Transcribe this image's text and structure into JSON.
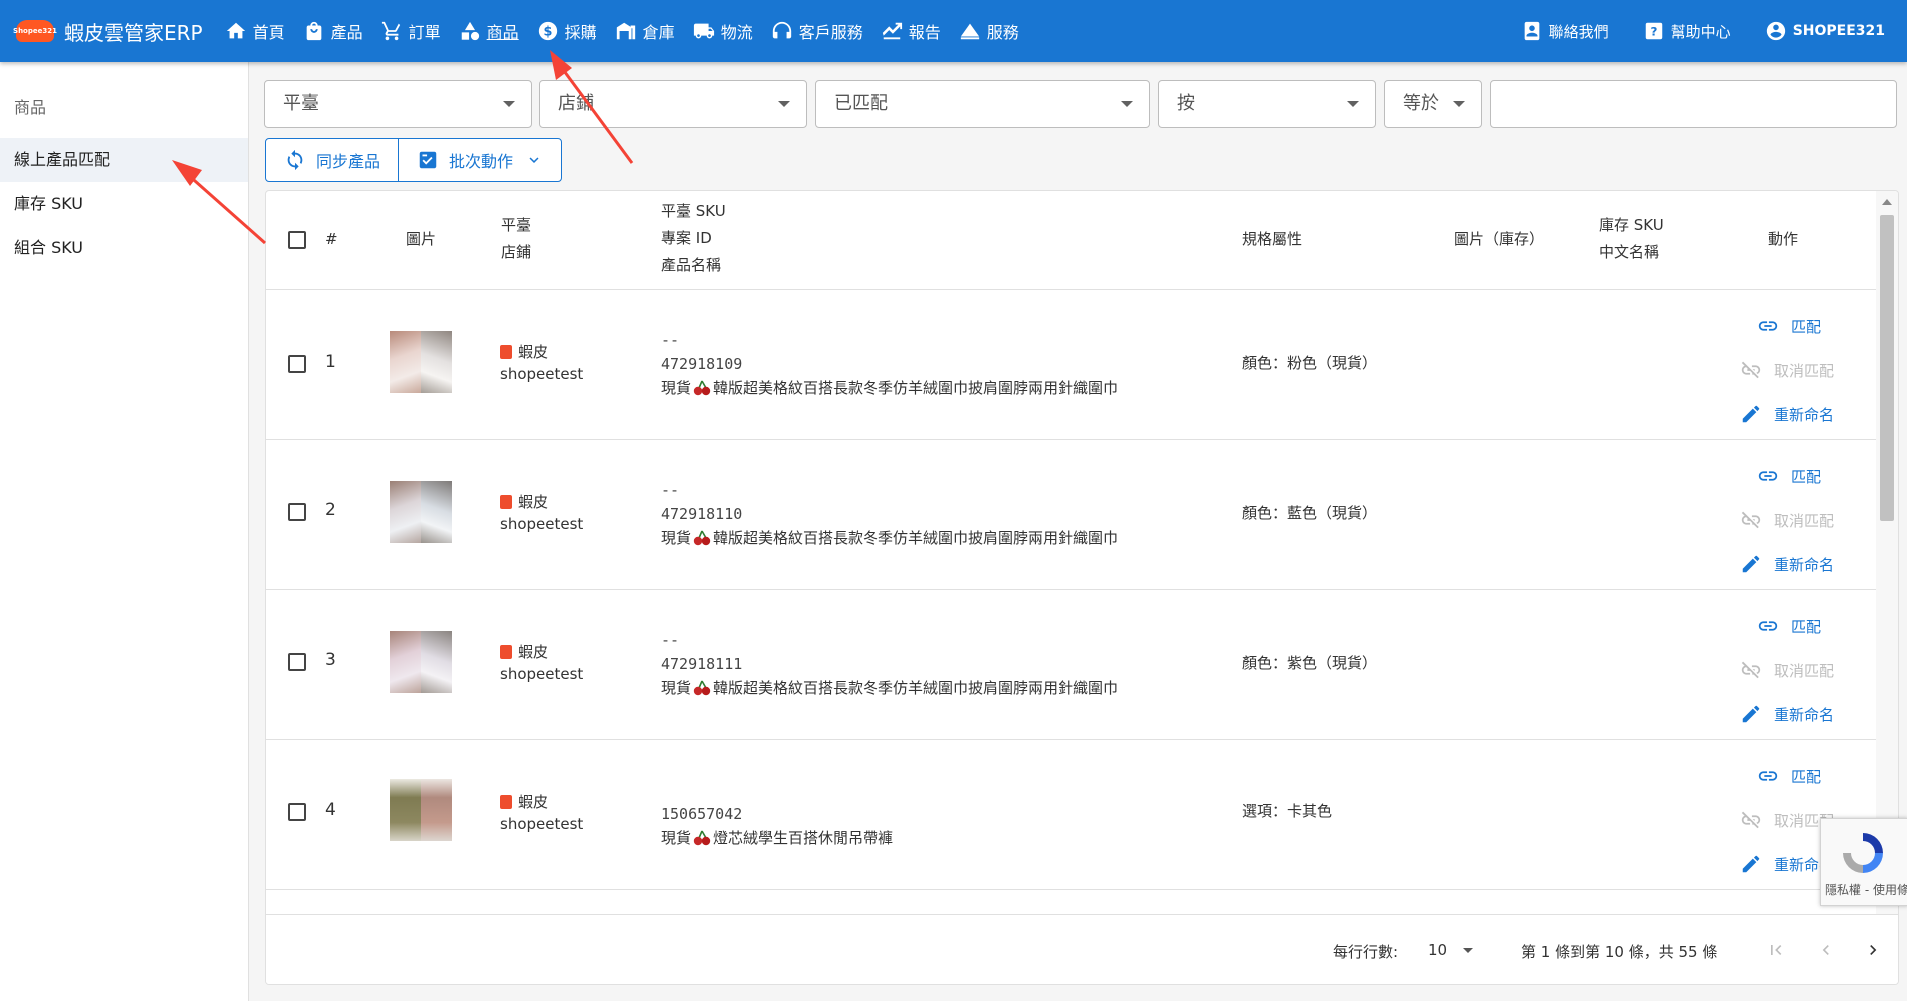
{
  "topbar": {
    "brand_title": "蝦皮雲管家ERP",
    "brand_logo_text": "Shopee321",
    "nav": [
      {
        "label": "首頁",
        "icon": "home-icon"
      },
      {
        "label": "產品",
        "icon": "shopping-bag-icon"
      },
      {
        "label": "訂單",
        "icon": "cart-icon"
      },
      {
        "label": "商品",
        "icon": "shapes-icon"
      },
      {
        "label": "採購",
        "icon": "dollar-icon"
      },
      {
        "label": "倉庫",
        "icon": "warehouse-icon"
      },
      {
        "label": "物流",
        "icon": "truck-icon"
      },
      {
        "label": "客戶服務",
        "icon": "headset-icon"
      },
      {
        "label": "報告",
        "icon": "chart-icon"
      },
      {
        "label": "服務",
        "icon": "cloud-icon"
      }
    ],
    "right": [
      {
        "label": "聯絡我們",
        "icon": "contact-icon"
      },
      {
        "label": "幫助中心",
        "icon": "help-icon"
      },
      {
        "label": "SHOPEE321",
        "icon": "account-icon"
      }
    ]
  },
  "sidebar": {
    "header": "商品",
    "items": [
      "線上產品匹配",
      "庫存 SKU",
      "組合 SKU"
    ]
  },
  "filters": {
    "platform": "平臺",
    "store": "店鋪",
    "matched": "已匹配",
    "by": "按",
    "op": "等於",
    "query": ""
  },
  "actions": {
    "sync": "同步產品",
    "batch": "批次動作"
  },
  "table": {
    "headers": {
      "index": "#",
      "image": "圖片",
      "platform": "平臺",
      "store": "店鋪",
      "platform_sku": "平臺 SKU",
      "project_id": "專案 ID",
      "product_name": "產品名稱",
      "spec": "規格屬性",
      "image_stock": "圖片（庫存）",
      "stock_sku": "庫存 SKU",
      "cn_name": "中文名稱",
      "actions": "動作"
    },
    "rows": [
      {
        "index": "1",
        "platform": "蝦皮",
        "store": "shopeetest",
        "sku": "--",
        "id": "472918109",
        "name_prefix": "現貨",
        "name": "韓版超美格紋百搭長款冬季仿羊絨圍巾披肩圍脖兩用針織圍巾",
        "spec": "顏色：粉色（現貨）"
      },
      {
        "index": "2",
        "platform": "蝦皮",
        "store": "shopeetest",
        "sku": "--",
        "id": "472918110",
        "name_prefix": "現貨",
        "name": "韓版超美格紋百搭長款冬季仿羊絨圍巾披肩圍脖兩用針織圍巾",
        "spec": "顏色：藍色（現貨）"
      },
      {
        "index": "3",
        "platform": "蝦皮",
        "store": "shopeetest",
        "sku": "--",
        "id": "472918111",
        "name_prefix": "現貨",
        "name": "韓版超美格紋百搭長款冬季仿羊絨圍巾披肩圍脖兩用針織圍巾",
        "spec": "顏色：紫色（現貨）"
      },
      {
        "index": "4",
        "platform": "蝦皮",
        "store": "shopeetest",
        "sku": "",
        "id": "150657042",
        "name_prefix": "現貨",
        "name": "燈芯絨學生百搭休閒吊帶褲",
        "spec": "選項：卡其色"
      }
    ],
    "row_actions": {
      "match": "匹配",
      "unmatch": "取消匹配",
      "rename": "重新命名"
    }
  },
  "pagination": {
    "rows_per_page_label": "每行行數:",
    "rows_per_page": "10",
    "range_text": "第 1 條到第 10 條，共 55 條"
  },
  "recaptcha": {
    "text": "隱私權 - 使用條款"
  },
  "colors": {
    "primary": "#1976d2",
    "shopee": "#ee4d2d",
    "annotation": "#f44336"
  }
}
